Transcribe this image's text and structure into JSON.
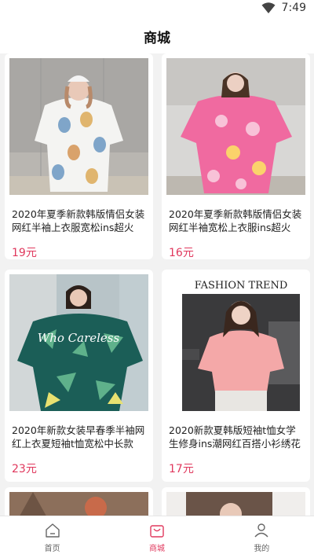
{
  "status_bar": {
    "time": "7:49"
  },
  "header": {
    "title": "商城"
  },
  "products": [
    {
      "name": "2020年夏季新款韩版情侣女装网红半袖上衣服宽松ins超火短...",
      "price": "19元"
    },
    {
      "name": "2020年夏季新款韩版情侣女装网红半袖宽松上衣服ins超火短...",
      "price": "16元"
    },
    {
      "name": "2020年新款女装早春季半袖网红上衣夏短袖t恤宽松中长款蹦...",
      "price": "23元"
    },
    {
      "name": "2020新款夏韩版短袖t恤女学生修身ins潮网红百搭小衫绣花时...",
      "price": "17元"
    }
  ],
  "product_images": {
    "p4_text_top": "FASHION TREND",
    "p3_shirt_text": "Who Careless"
  },
  "tabbar": {
    "home_label": "首页",
    "mall_label": "商城",
    "mine_label": "我的"
  },
  "colors": {
    "accent": "#e0385d",
    "background": "#f2f2f2"
  }
}
